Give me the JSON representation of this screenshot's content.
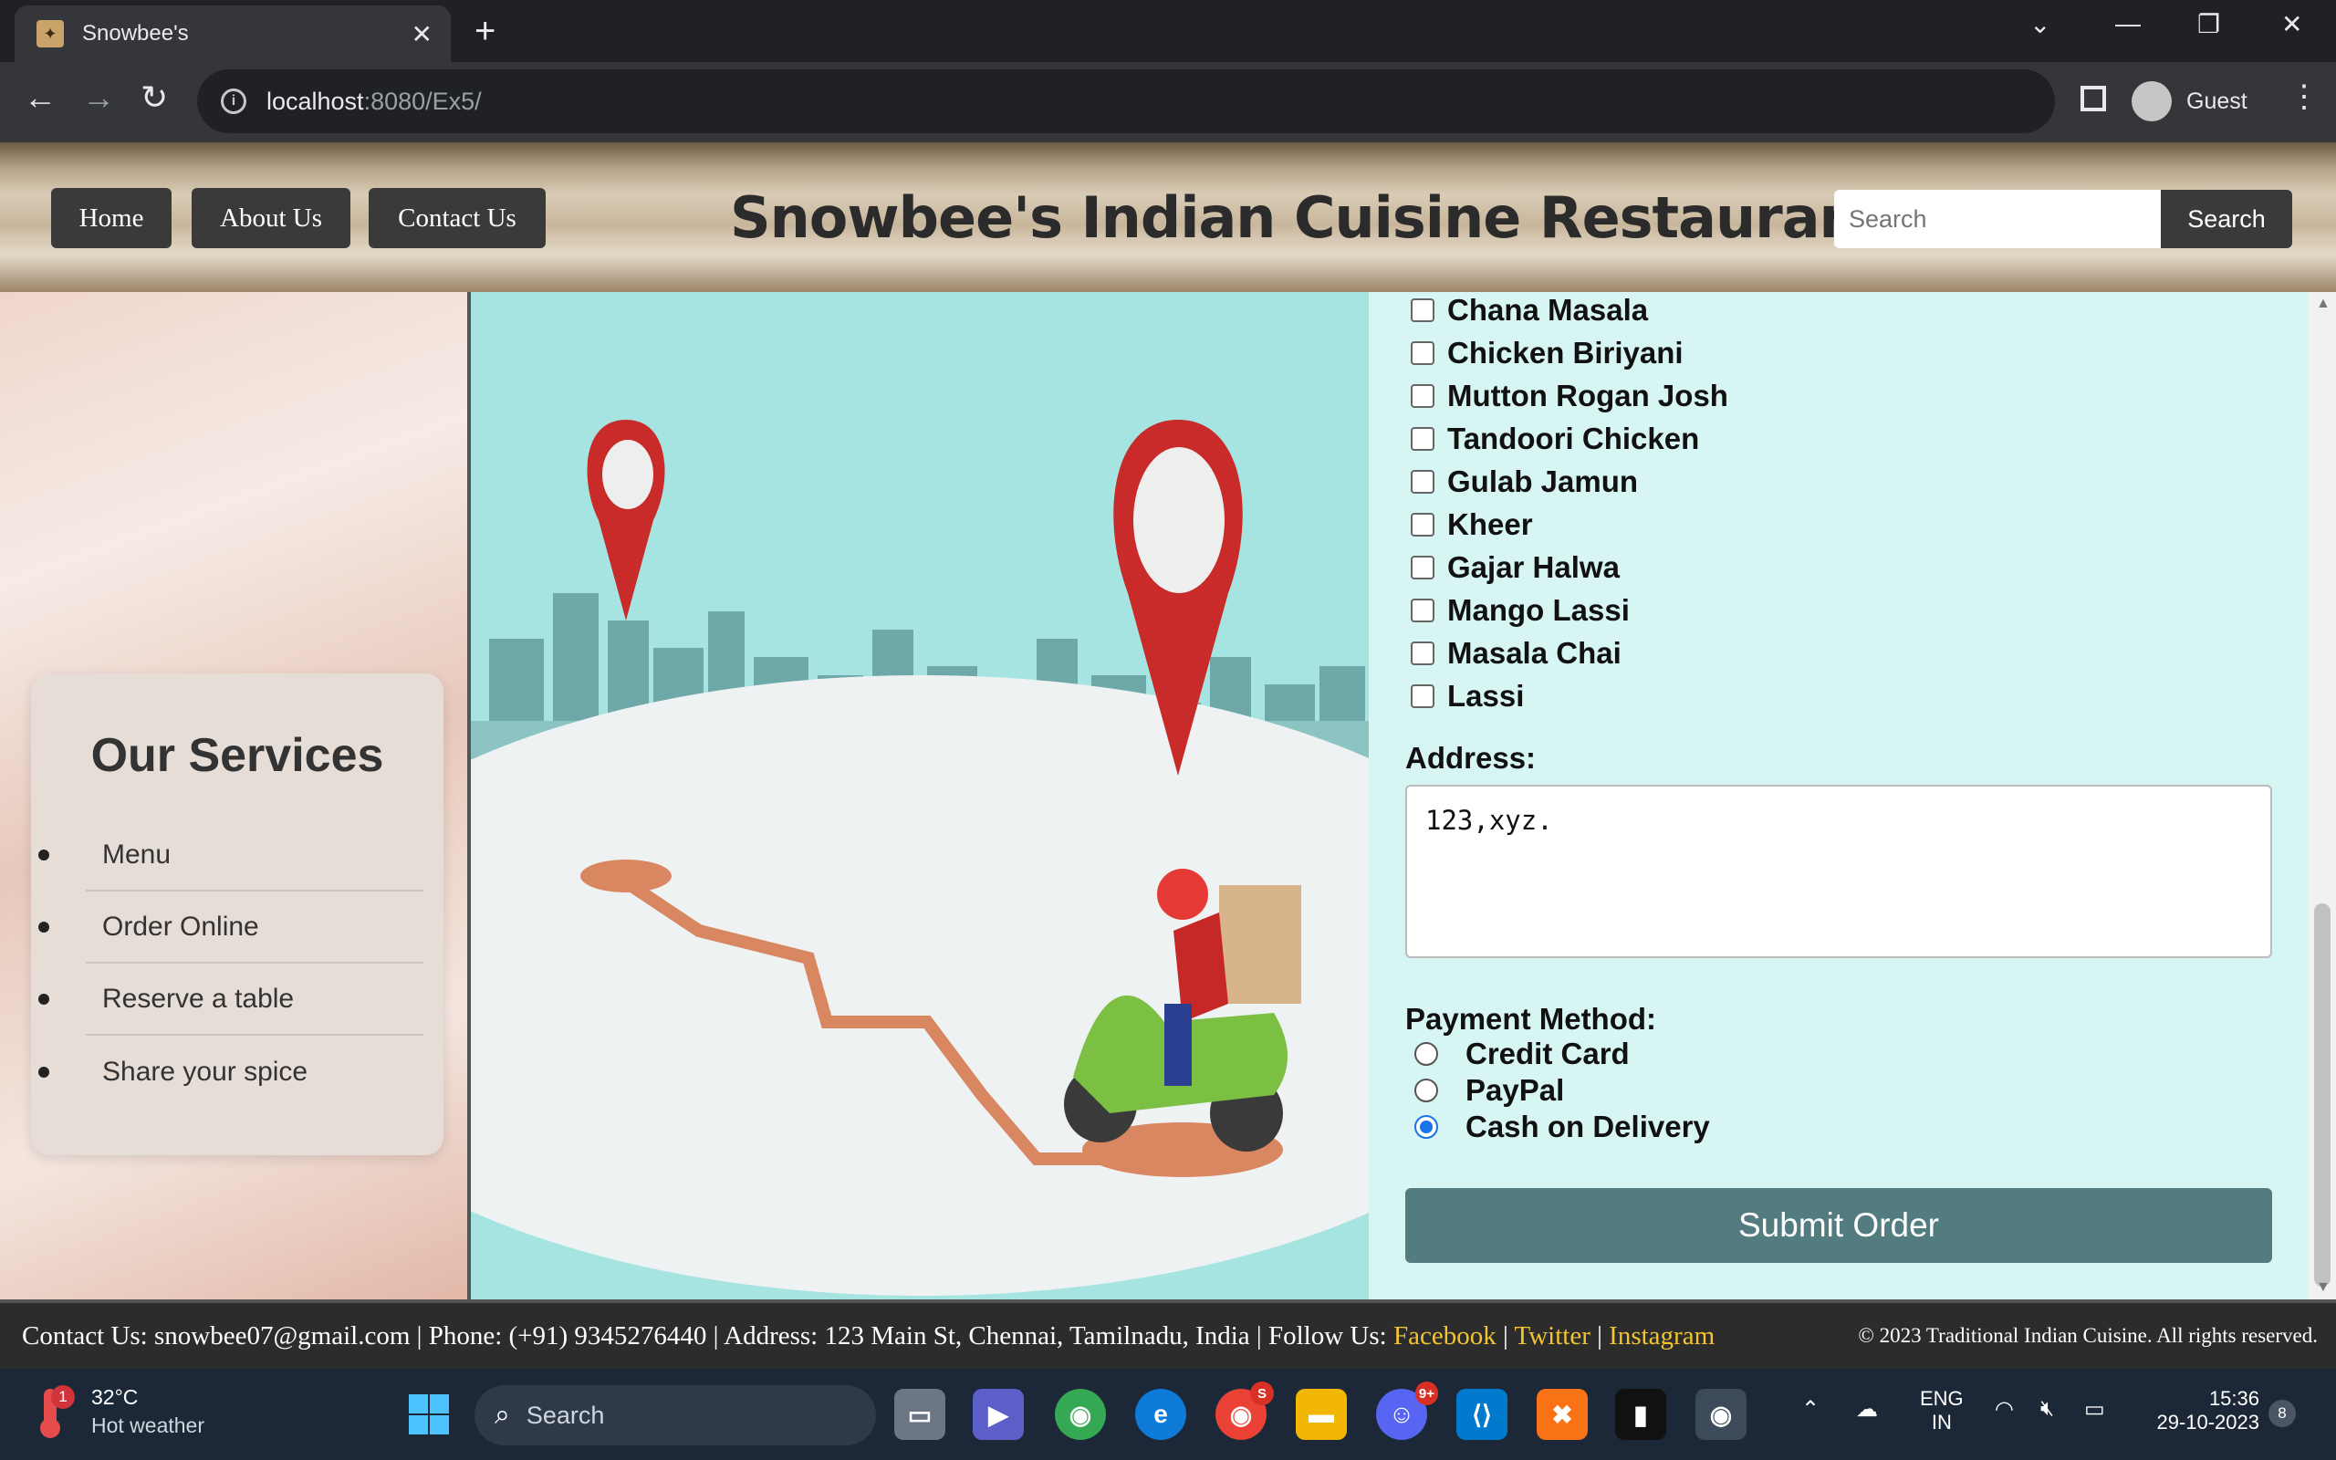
{
  "browser": {
    "tab_title": "Snowbee's",
    "url_host": "localhost",
    "url_rest": ":8080/Ex5/",
    "profile_label": "Guest"
  },
  "header": {
    "nav": [
      "Home",
      "About Us",
      "Contact Us"
    ],
    "title": "Snowbee's Indian Cuisine Restaurant",
    "search_placeholder": "Search",
    "search_button": "Search"
  },
  "services": {
    "title": "Our Services",
    "items": [
      "Menu",
      "Order Online",
      "Reserve a table",
      "Share your spice"
    ]
  },
  "order_form": {
    "dishes": [
      "Chana Masala",
      "Chicken Biriyani",
      "Mutton Rogan Josh",
      "Tandoori Chicken",
      "Gulab Jamun",
      "Kheer",
      "Gajar Halwa",
      "Mango Lassi",
      "Masala Chai",
      "Lassi"
    ],
    "address_label": "Address:",
    "address_value": "123,xyz.",
    "payment_label": "Payment Method:",
    "payment_options": [
      "Credit Card",
      "PayPal",
      "Cash on Delivery"
    ],
    "payment_selected": "Cash on Delivery",
    "submit_label": "Submit Order"
  },
  "footer": {
    "contact_prefix": "Contact Us: snowbee07@gmail.com | Phone: (+91) 9345276440 | Address: 123 Main St, Chennai, Tamilnadu, India | Follow Us: ",
    "links": [
      "Facebook",
      "Twitter",
      "Instagram"
    ],
    "separator": " | ",
    "copyright": "© 2023 Traditional Indian Cuisine. All rights reserved."
  },
  "taskbar": {
    "temperature": "32°C",
    "weather_desc": "Hot weather",
    "weather_badge": "1",
    "search_label": "Search",
    "language_line1": "ENG",
    "language_line2": "IN",
    "time": "15:36",
    "date": "29-10-2023",
    "notification_count": "8",
    "discord_badge": "9+",
    "chrome_badge": "S"
  },
  "colors": {
    "accent_link": "#f2c530",
    "submit_button": "#527c80",
    "order_panel": "#d6f5f3",
    "radio_selected": "#1a73e8"
  }
}
